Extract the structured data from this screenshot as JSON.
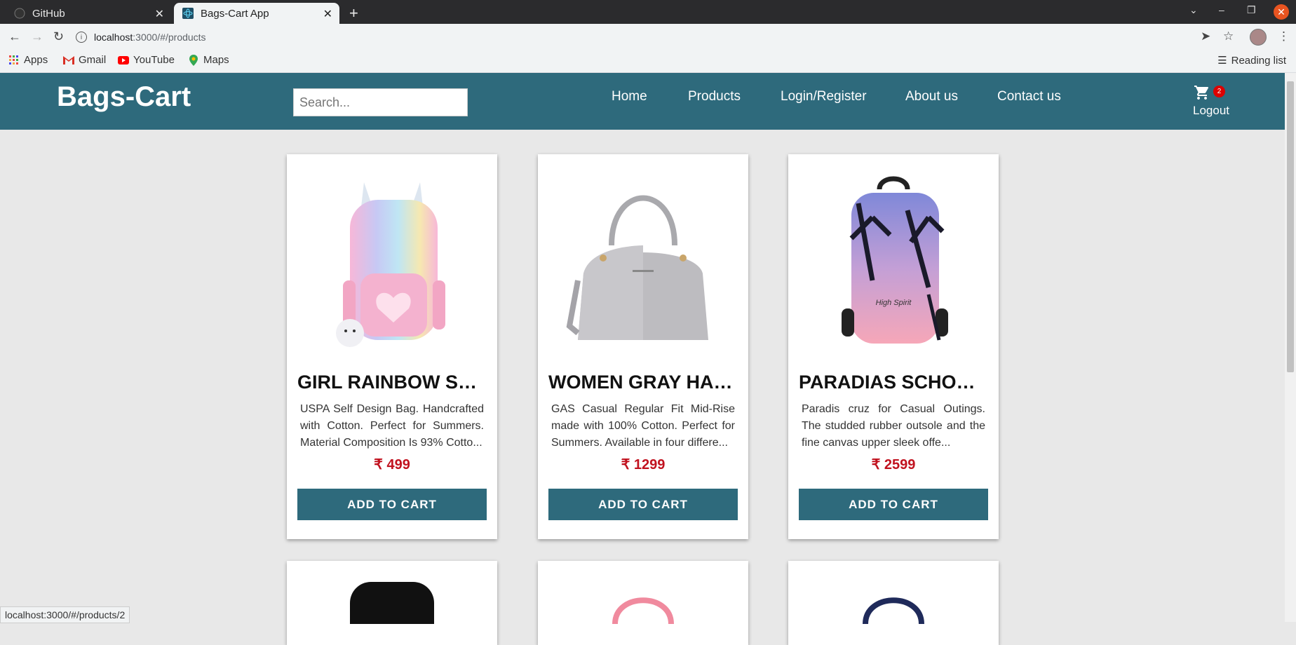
{
  "browser": {
    "tabs": [
      {
        "title": "GitHub",
        "icon": "github-icon"
      },
      {
        "title": "Bags-Cart App",
        "icon": "react-icon"
      }
    ],
    "url_host": "localhost",
    "url_rest": ":3000/#/products",
    "bookmarks": [
      {
        "label": "Apps",
        "icon": "apps-grid-icon"
      },
      {
        "label": "Gmail",
        "icon": "gmail-icon"
      },
      {
        "label": "YouTube",
        "icon": "youtube-icon"
      },
      {
        "label": "Maps",
        "icon": "maps-icon"
      }
    ],
    "reading_list": "Reading list",
    "status_url": "localhost:3000/#/products/2",
    "colors": {
      "close_button": "#e95420"
    }
  },
  "header": {
    "brand": "Bags-Cart",
    "search_placeholder": "Search...",
    "nav": [
      "Home",
      "Products",
      "Login/Register",
      "About us",
      "Contact us"
    ],
    "cart_count": "2",
    "logout": "Logout",
    "colors": {
      "bar": "#2e6a7c",
      "price": "#c1121f"
    }
  },
  "products": [
    {
      "title": "GIRL RAINBOW SC...",
      "description": "USPA Self Design Bag. Handcrafted with Cotton. Perfect for Summers. Material Composition Is 93% Cotto...",
      "price": "₹ 499",
      "button": "ADD TO CART",
      "image": "rainbow-backpack"
    },
    {
      "title": "WOMEN GRAY HAN...",
      "description": "GAS Casual Regular Fit Mid-Rise made with 100% Cotton. Perfect for Summers. Available in four differe...",
      "price": "₹ 1299",
      "button": "ADD TO CART",
      "image": "gray-handbag"
    },
    {
      "title": "PARADIAS SCHOOL...",
      "description": "Paradis cruz for Casual Outings. The studded rubber outsole and the fine canvas upper sleek offe...",
      "price": "₹ 2599",
      "button": "ADD TO CART",
      "image": "palm-backpack"
    }
  ]
}
